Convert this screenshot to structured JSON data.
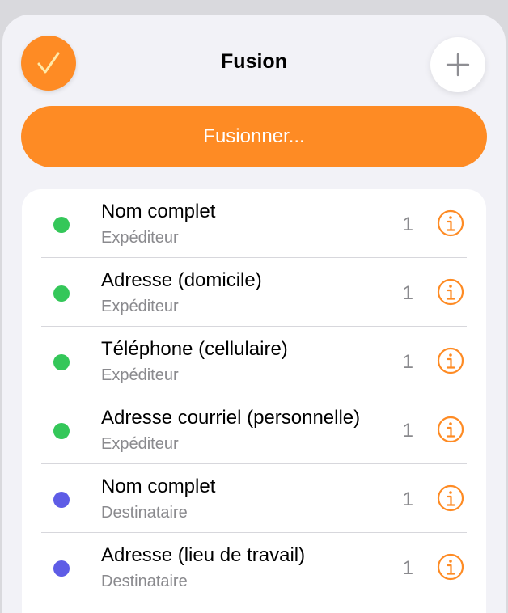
{
  "colors": {
    "accent": "#fe8b24",
    "sender_dot": "#34c759",
    "recipient_dot": "#5e5ce6"
  },
  "header": {
    "title": "Fusion",
    "done_icon": "checkmark-icon",
    "add_icon": "plus-icon"
  },
  "merge_button": {
    "label": "Fusionner..."
  },
  "fields": [
    {
      "title": "Nom complet",
      "subtitle": "Expéditeur",
      "count": "1",
      "role": "sender",
      "dot_color": "#34c759"
    },
    {
      "title": "Adresse (domicile)",
      "subtitle": "Expéditeur",
      "count": "1",
      "role": "sender",
      "dot_color": "#34c759"
    },
    {
      "title": "Téléphone (cellulaire)",
      "subtitle": "Expéditeur",
      "count": "1",
      "role": "sender",
      "dot_color": "#34c759"
    },
    {
      "title": "Adresse courriel (personnelle)",
      "subtitle": "Expéditeur",
      "count": "1",
      "role": "sender",
      "dot_color": "#34c759"
    },
    {
      "title": "Nom complet",
      "subtitle": "Destinataire",
      "count": "1",
      "role": "recipient",
      "dot_color": "#5e5ce6"
    },
    {
      "title": "Adresse (lieu de travail)",
      "subtitle": "Destinataire",
      "count": "1",
      "role": "recipient",
      "dot_color": "#5e5ce6"
    }
  ]
}
